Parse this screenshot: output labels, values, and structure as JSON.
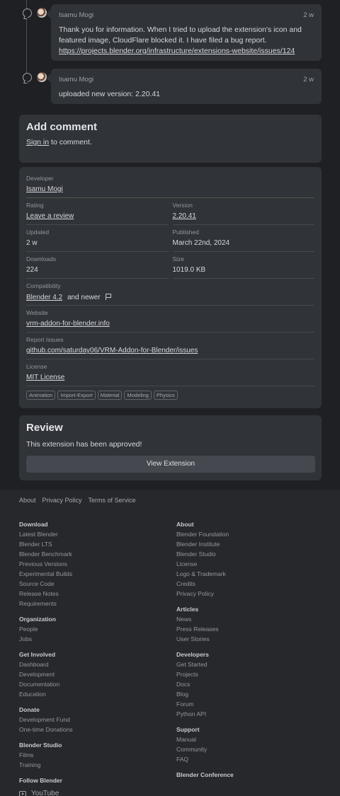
{
  "comments": [
    {
      "author": "Isamu Mogi",
      "time": "2 w",
      "text": "Thank you for information. When I tried to upload the extension's icon and featured image, CloudFlare blocked it. I have filed a bug report.",
      "link": "https://projects.blender.org/infrastructure/extensions-website/issues/124"
    },
    {
      "author": "Isamu Mogi",
      "time": "2 w",
      "text": "uploaded new version: 2.20.41"
    }
  ],
  "add_comment": {
    "title": "Add comment",
    "sign_in": "Sign in",
    "suffix": " to comment."
  },
  "details": {
    "developer_label": "Developer",
    "developer": "Isamu Mogi",
    "rating_label": "Rating",
    "rating": "Leave a review",
    "version_label": "Version",
    "version": "2.20.41",
    "updated_label": "Updated",
    "updated": "2 w",
    "published_label": "Published",
    "published": "March 22nd, 2024",
    "downloads_label": "Downloads",
    "downloads": "224",
    "size_label": "Size",
    "size": "1019.0 KB",
    "compat_label": "Compatibility",
    "compat": "Blender 4.2",
    "compat_suffix": "and newer",
    "website_label": "Website",
    "website": "vrm-addon-for-blender.info",
    "issues_label": "Report Issues",
    "issues": "github.com/saturday06/VRM-Addon-for-Blender/issues",
    "license_label": "License",
    "license": "MIT License",
    "tags": [
      "Animation",
      "Import-Export",
      "Material",
      "Modeling",
      "Physics"
    ]
  },
  "review": {
    "title": "Review",
    "status": "This extension has been approved!",
    "button": "View Extension"
  },
  "footer": {
    "top_links": [
      "About",
      "Privacy Policy",
      "Terms of Service"
    ],
    "left": [
      {
        "title": "Download",
        "links": [
          "Latest Blender",
          "Blender LTS",
          "Blender Benchmark",
          "Previous Versions",
          "Experimental Builds",
          "Source Code",
          "Release Notes",
          "Requirements"
        ]
      },
      {
        "title": "Organization",
        "links": [
          "People",
          "Jobs"
        ]
      },
      {
        "title": "Get Involved",
        "links": [
          "Dashboard",
          "Development",
          "Documentation",
          "Education"
        ]
      },
      {
        "title": "Donate",
        "links": [
          "Development Fund",
          "One-time Donations"
        ]
      },
      {
        "title": "Blender Studio",
        "links": [
          "Films",
          "Training"
        ]
      },
      {
        "title": "Follow Blender",
        "links": []
      }
    ],
    "right": [
      {
        "title": "About",
        "links": [
          "Blender Foundation",
          "Blender Institute",
          "Blender Studio",
          "License",
          "Logo & Trademark",
          "Credits",
          "Privacy Policy"
        ]
      },
      {
        "title": "Articles",
        "links": [
          "News",
          "Press Releases",
          "User Stories"
        ]
      },
      {
        "title": "Developers",
        "links": [
          "Get Started",
          "Projects",
          "Docs",
          "Blog",
          "Forum",
          "Python API"
        ]
      },
      {
        "title": "Support",
        "links": [
          "Manual",
          "Community",
          "FAQ"
        ]
      },
      {
        "title": "Blender Conference",
        "links": []
      }
    ],
    "youtube": "YouTube"
  }
}
